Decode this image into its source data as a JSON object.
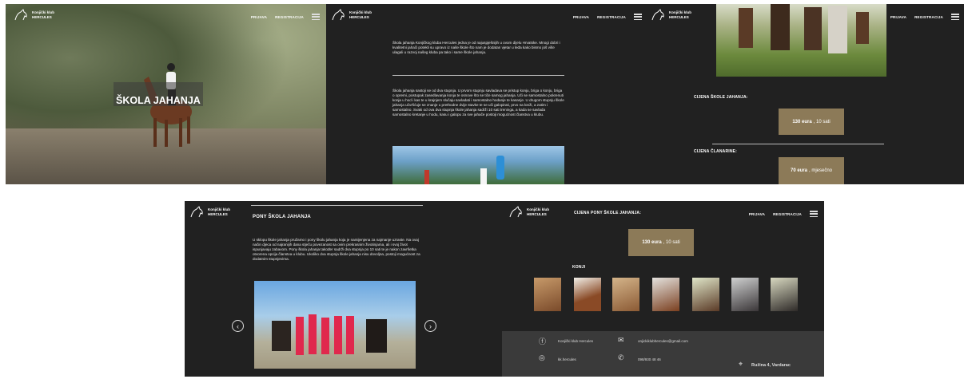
{
  "brand": {
    "line1": "Konjički klub",
    "line2": "HERCULES"
  },
  "nav": {
    "login": "PRIJAVA",
    "register": "REGISTRACIJA"
  },
  "panel1": {
    "title": "ŠKOLA JAHANJA"
  },
  "panel2": {
    "para1": "Škola jahanja Konjičkog kluba Hercules jedna je od najuspješnijih u ovom dijelu Hrvatske. Mnogi dobri i kvalitetni jahači potekli su upravo iz naše škole što nam je dodatan vjetar u leđa kako bismo još više ulagali u razvoj našeg kluba pa tako i same škole jahanja.",
    "para2": "Škola jahanja sastoji se od dva stupnja. U prvom stupnju savladava se pristup konju, briga o konju, briga o opremi, postupak zasedlavanja konja te osnove što se tiče samog jahanja. Uči se samostalno pokrenuti konja u hod i kas te u krajnjem slučaju savladati i samostalno hodanje te kasanje. U drugom stupnju škole jahanja učvršćuje se znanje u prethodne dvije stavke te se uči galopirati, prvo na lonži, a zatim i samostalno. Svaki od ova dva stupnja škole jahanja sadrži 10 sati treninga, a kada se savlada samostalno kretanje u hodu, kasu i galopu za sve jahače postoji mogućnost članstva u klubu."
  },
  "panel3": {
    "price_title": "CIJENA ŠKOLE JAHANJA:",
    "price_amount": "130 eura",
    "price_rest": ", 10 sati",
    "membership_title": "CIJENA ČLANARINE:",
    "membership_amount": "70 eura",
    "membership_rest": ", mjesečno"
  },
  "panel4": {
    "title": "PONY ŠKOLA JAHANJA",
    "para": "U sklopu škole jahanja pružamo i pony školu jahanja koja je namijenjena za najmanje uzraste. Na ovaj način djeca od najranijih dana stječu povezanost sa ovim prekrasnim životinjama, ali i svoj život ispunjavaju zabavom. Pony škola jahanja također sadrži dva stupnja po 10 sati te je nakon završetka otvorena opcija članstva u klubu. Ukoliko dva stupnja škole jahanja nisu dovoljna, postoji mogućnost za dodatnim stupnjevima.",
    "prev": "‹",
    "next": "›"
  },
  "panel5": {
    "title": "CIJENA PONY ŠKOLE JAHANJA:",
    "price_amount": "130 eura",
    "price_rest": ", 10 sati",
    "horses_title": "KONJI",
    "footer": {
      "facebook": "Konjički klub Hercules",
      "email": "onjickiklubhercules@gmail.com",
      "instagram": "kk.hercules",
      "phone": "098/930 48 46",
      "address": "Ružina 4, Vardarac"
    }
  },
  "colors": {
    "panel_bg": "#212121",
    "price_bg": "#8c7a58",
    "footer_bg": "#3a3a3a"
  }
}
